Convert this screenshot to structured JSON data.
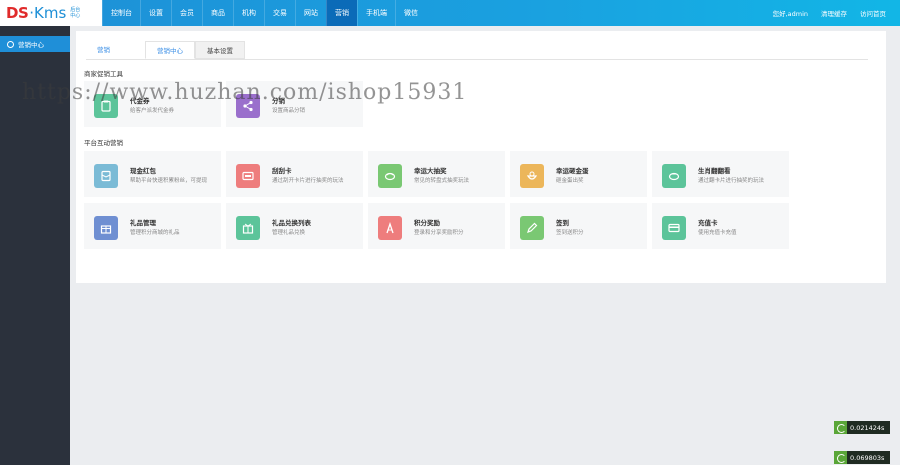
{
  "logo": {
    "ds": "DS",
    "kms": "·Kms",
    "sub": "后台中心"
  },
  "nav": [
    {
      "label": "控制台",
      "active": false
    },
    {
      "label": "设置",
      "active": false
    },
    {
      "label": "会员",
      "active": false
    },
    {
      "label": "商品",
      "active": false
    },
    {
      "label": "机构",
      "active": false
    },
    {
      "label": "交易",
      "active": false
    },
    {
      "label": "网站",
      "active": false
    },
    {
      "label": "营销",
      "active": true
    },
    {
      "label": "手机端",
      "active": false
    },
    {
      "label": "微信",
      "active": false
    }
  ],
  "topright": {
    "greeting": "您好,admin",
    "clear_cache": "清理缓存",
    "visit_home": "访问首页"
  },
  "sidebar": {
    "item": "营销中心"
  },
  "tabs": {
    "t1": "营销",
    "t2": "营销中心",
    "t3": "基本设置"
  },
  "sections": {
    "merchant": "商家促销工具",
    "platform": "平台互动营销"
  },
  "merchant_cards": [
    {
      "name": "代金券",
      "desc": "给客户派发代金券",
      "color": "#5cc49a",
      "icon": "clipboard-icon"
    },
    {
      "name": "分销",
      "desc": "设置商品分销",
      "color": "#9a6fcc",
      "icon": "share-icon"
    }
  ],
  "platform_cards": [
    {
      "name": "现金红包",
      "desc": "帮助平台快速积累粉丝，可提现",
      "color": "#7bbbd6",
      "icon": "red-packet-icon"
    },
    {
      "name": "刮刮卡",
      "desc": "通过刮开卡片进行抽奖的玩法",
      "color": "#ee7d7d",
      "icon": "card-icon"
    },
    {
      "name": "幸运大抽奖",
      "desc": "常见的转盘式抽奖玩法",
      "color": "#7ac873",
      "icon": "wheel-icon"
    },
    {
      "name": "幸运砸金蛋",
      "desc": "砸金蛋出奖",
      "color": "#ecb65a",
      "icon": "egg-icon"
    },
    {
      "name": "生肖翻翻看",
      "desc": "通过翻卡片进行抽奖的玩法",
      "color": "#5cc49a",
      "icon": "flip-icon"
    },
    {
      "name": "礼品管理",
      "desc": "管理积分商城的礼品",
      "color": "#6f8fd2",
      "icon": "gift-icon"
    },
    {
      "name": "礼品兑换列表",
      "desc": "管理礼品兑换",
      "color": "#5cc49a",
      "icon": "gift-list-icon"
    },
    {
      "name": "积分奖励",
      "desc": "登录和分享奖励积分",
      "color": "#ee7d7d",
      "icon": "points-icon"
    },
    {
      "name": "签到",
      "desc": "签到送积分",
      "color": "#7ac873",
      "icon": "pencil-icon"
    },
    {
      "name": "充值卡",
      "desc": "使用充值卡充值",
      "color": "#5cc49a",
      "icon": "recharge-card-icon"
    }
  ],
  "watermark": "https://www.huzhan.com/ishop15931",
  "timers": [
    "0.021424s",
    "0.069803s"
  ]
}
